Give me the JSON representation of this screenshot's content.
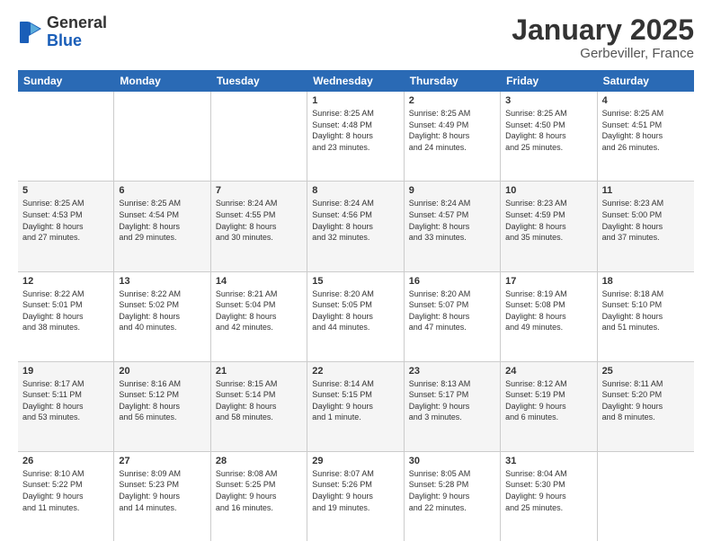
{
  "logo": {
    "general": "General",
    "blue": "Blue"
  },
  "title": "January 2025",
  "location": "Gerbeviller, France",
  "days": [
    "Sunday",
    "Monday",
    "Tuesday",
    "Wednesday",
    "Thursday",
    "Friday",
    "Saturday"
  ],
  "rows": [
    [
      {
        "day": "",
        "text": ""
      },
      {
        "day": "",
        "text": ""
      },
      {
        "day": "",
        "text": ""
      },
      {
        "day": "1",
        "text": "Sunrise: 8:25 AM\nSunset: 4:48 PM\nDaylight: 8 hours\nand 23 minutes."
      },
      {
        "day": "2",
        "text": "Sunrise: 8:25 AM\nSunset: 4:49 PM\nDaylight: 8 hours\nand 24 minutes."
      },
      {
        "day": "3",
        "text": "Sunrise: 8:25 AM\nSunset: 4:50 PM\nDaylight: 8 hours\nand 25 minutes."
      },
      {
        "day": "4",
        "text": "Sunrise: 8:25 AM\nSunset: 4:51 PM\nDaylight: 8 hours\nand 26 minutes."
      }
    ],
    [
      {
        "day": "5",
        "text": "Sunrise: 8:25 AM\nSunset: 4:53 PM\nDaylight: 8 hours\nand 27 minutes."
      },
      {
        "day": "6",
        "text": "Sunrise: 8:25 AM\nSunset: 4:54 PM\nDaylight: 8 hours\nand 29 minutes."
      },
      {
        "day": "7",
        "text": "Sunrise: 8:24 AM\nSunset: 4:55 PM\nDaylight: 8 hours\nand 30 minutes."
      },
      {
        "day": "8",
        "text": "Sunrise: 8:24 AM\nSunset: 4:56 PM\nDaylight: 8 hours\nand 32 minutes."
      },
      {
        "day": "9",
        "text": "Sunrise: 8:24 AM\nSunset: 4:57 PM\nDaylight: 8 hours\nand 33 minutes."
      },
      {
        "day": "10",
        "text": "Sunrise: 8:23 AM\nSunset: 4:59 PM\nDaylight: 8 hours\nand 35 minutes."
      },
      {
        "day": "11",
        "text": "Sunrise: 8:23 AM\nSunset: 5:00 PM\nDaylight: 8 hours\nand 37 minutes."
      }
    ],
    [
      {
        "day": "12",
        "text": "Sunrise: 8:22 AM\nSunset: 5:01 PM\nDaylight: 8 hours\nand 38 minutes."
      },
      {
        "day": "13",
        "text": "Sunrise: 8:22 AM\nSunset: 5:02 PM\nDaylight: 8 hours\nand 40 minutes."
      },
      {
        "day": "14",
        "text": "Sunrise: 8:21 AM\nSunset: 5:04 PM\nDaylight: 8 hours\nand 42 minutes."
      },
      {
        "day": "15",
        "text": "Sunrise: 8:20 AM\nSunset: 5:05 PM\nDaylight: 8 hours\nand 44 minutes."
      },
      {
        "day": "16",
        "text": "Sunrise: 8:20 AM\nSunset: 5:07 PM\nDaylight: 8 hours\nand 47 minutes."
      },
      {
        "day": "17",
        "text": "Sunrise: 8:19 AM\nSunset: 5:08 PM\nDaylight: 8 hours\nand 49 minutes."
      },
      {
        "day": "18",
        "text": "Sunrise: 8:18 AM\nSunset: 5:10 PM\nDaylight: 8 hours\nand 51 minutes."
      }
    ],
    [
      {
        "day": "19",
        "text": "Sunrise: 8:17 AM\nSunset: 5:11 PM\nDaylight: 8 hours\nand 53 minutes."
      },
      {
        "day": "20",
        "text": "Sunrise: 8:16 AM\nSunset: 5:12 PM\nDaylight: 8 hours\nand 56 minutes."
      },
      {
        "day": "21",
        "text": "Sunrise: 8:15 AM\nSunset: 5:14 PM\nDaylight: 8 hours\nand 58 minutes."
      },
      {
        "day": "22",
        "text": "Sunrise: 8:14 AM\nSunset: 5:15 PM\nDaylight: 9 hours\nand 1 minute."
      },
      {
        "day": "23",
        "text": "Sunrise: 8:13 AM\nSunset: 5:17 PM\nDaylight: 9 hours\nand 3 minutes."
      },
      {
        "day": "24",
        "text": "Sunrise: 8:12 AM\nSunset: 5:19 PM\nDaylight: 9 hours\nand 6 minutes."
      },
      {
        "day": "25",
        "text": "Sunrise: 8:11 AM\nSunset: 5:20 PM\nDaylight: 9 hours\nand 8 minutes."
      }
    ],
    [
      {
        "day": "26",
        "text": "Sunrise: 8:10 AM\nSunset: 5:22 PM\nDaylight: 9 hours\nand 11 minutes."
      },
      {
        "day": "27",
        "text": "Sunrise: 8:09 AM\nSunset: 5:23 PM\nDaylight: 9 hours\nand 14 minutes."
      },
      {
        "day": "28",
        "text": "Sunrise: 8:08 AM\nSunset: 5:25 PM\nDaylight: 9 hours\nand 16 minutes."
      },
      {
        "day": "29",
        "text": "Sunrise: 8:07 AM\nSunset: 5:26 PM\nDaylight: 9 hours\nand 19 minutes."
      },
      {
        "day": "30",
        "text": "Sunrise: 8:05 AM\nSunset: 5:28 PM\nDaylight: 9 hours\nand 22 minutes."
      },
      {
        "day": "31",
        "text": "Sunrise: 8:04 AM\nSunset: 5:30 PM\nDaylight: 9 hours\nand 25 minutes."
      },
      {
        "day": "",
        "text": ""
      }
    ]
  ]
}
